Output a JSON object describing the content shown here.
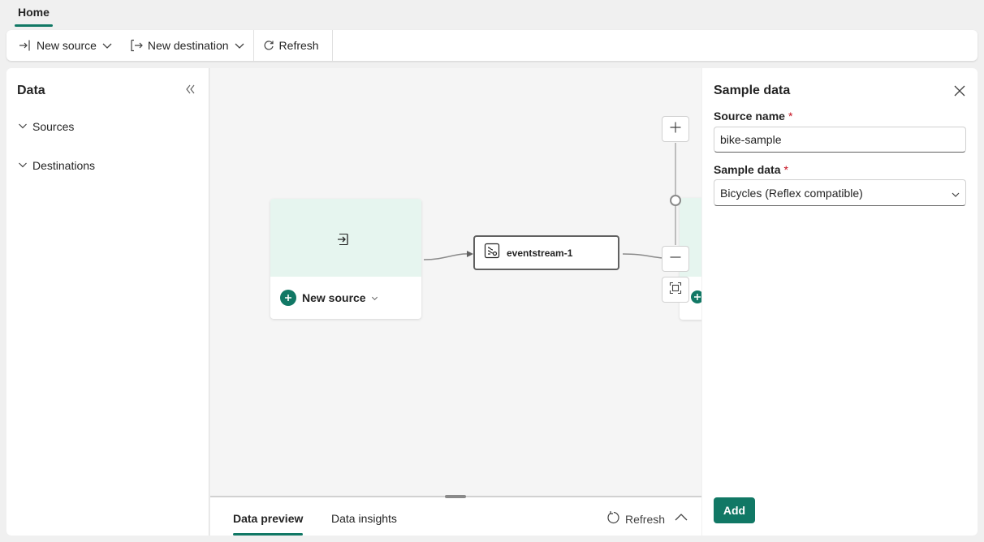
{
  "tabs": {
    "home": "Home"
  },
  "toolbar": {
    "new_source": "New source",
    "new_destination": "New destination",
    "refresh": "Refresh"
  },
  "left_panel": {
    "title": "Data",
    "items": [
      "Sources",
      "Destinations"
    ]
  },
  "canvas": {
    "source_card": {
      "add_label": "New source"
    },
    "eventstream_node": {
      "label": "eventstream-1"
    }
  },
  "bottom_panel": {
    "tabs": [
      "Data preview",
      "Data insights"
    ],
    "active_tab": "Data preview",
    "refresh": "Refresh"
  },
  "right_panel": {
    "title": "Sample data",
    "source_name": {
      "label": "Source name",
      "required_marker": "*",
      "value": "bike-sample"
    },
    "sample_data": {
      "label": "Sample data",
      "required_marker": "*",
      "selected": "Bicycles (Reflex compatible)"
    },
    "add_button": "Add"
  },
  "colors": {
    "accent": "#117865",
    "required": "#c50f1f",
    "canvas_bg": "#f5f5f5",
    "card_header_bg": "#e6f5ef"
  }
}
